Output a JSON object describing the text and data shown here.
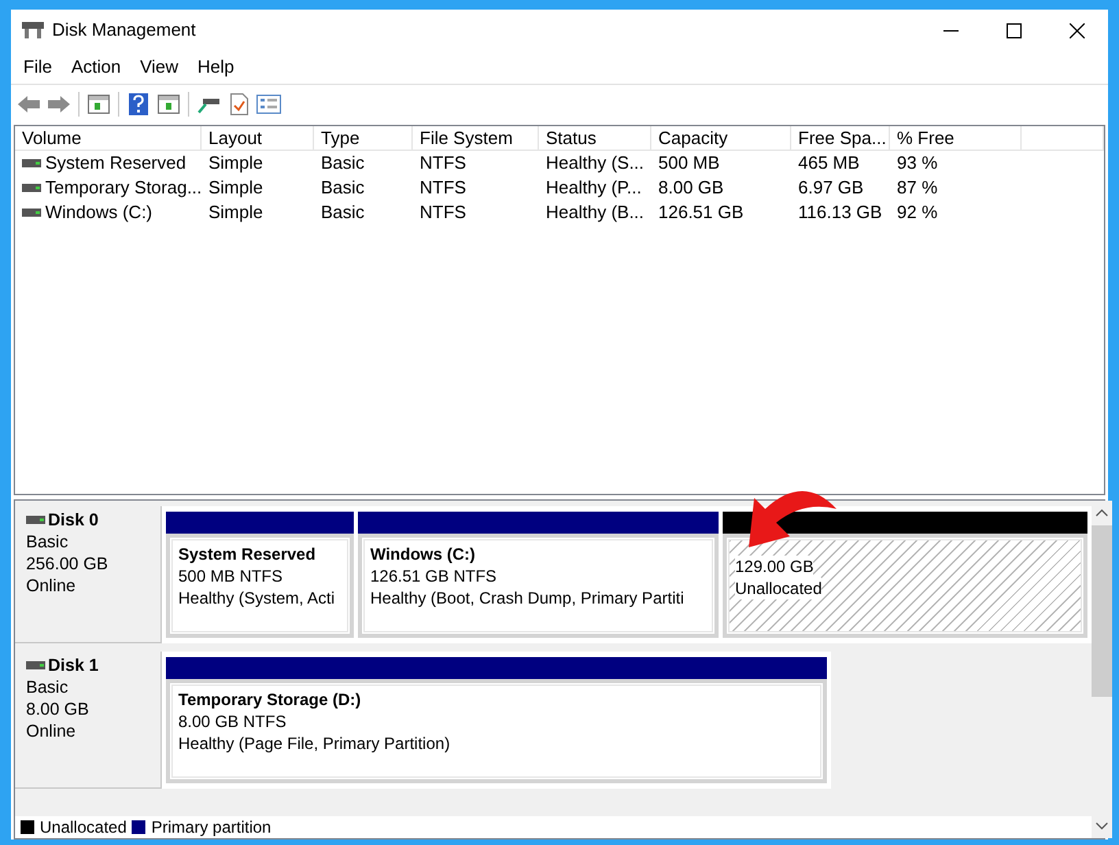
{
  "window": {
    "title": "Disk Management"
  },
  "menu": [
    "File",
    "Action",
    "View",
    "Help"
  ],
  "volume_table": {
    "columns": [
      "Volume",
      "Layout",
      "Type",
      "File System",
      "Status",
      "Capacity",
      "Free Spa...",
      "% Free"
    ],
    "rows": [
      {
        "cells": [
          "System Reserved",
          "Simple",
          "Basic",
          "NTFS",
          "Healthy (S...",
          "500 MB",
          "465 MB",
          "93 %"
        ]
      },
      {
        "cells": [
          "Temporary Storag...",
          "Simple",
          "Basic",
          "NTFS",
          "Healthy (P...",
          "8.00 GB",
          "6.97 GB",
          "87 %"
        ]
      },
      {
        "cells": [
          "Windows (C:)",
          "Simple",
          "Basic",
          "NTFS",
          "Healthy (B...",
          "126.51 GB",
          "116.13 GB",
          "92 %"
        ]
      }
    ]
  },
  "disks": [
    {
      "name": "Disk 0",
      "type": "Basic",
      "size": "256.00 GB",
      "status": "Online",
      "partitions": [
        {
          "kind": "primary",
          "title": "System Reserved",
          "detail": "500 MB NTFS",
          "status": "Healthy (System, Acti"
        },
        {
          "kind": "primary",
          "title": "Windows  (C:)",
          "detail": "126.51 GB NTFS",
          "status": "Healthy (Boot, Crash Dump, Primary Partiti"
        },
        {
          "kind": "unallocated",
          "detail": "129.00 GB",
          "status": "Unallocated"
        }
      ]
    },
    {
      "name": "Disk 1",
      "type": "Basic",
      "size": "8.00 GB",
      "status": "Online",
      "partitions": [
        {
          "kind": "primary",
          "title": "Temporary Storage  (D:)",
          "detail": "8.00 GB NTFS",
          "status": "Healthy (Page File, Primary Partition)"
        }
      ]
    }
  ],
  "legend": [
    {
      "label": "Unallocated",
      "color": "#000000"
    },
    {
      "label": "Primary partition",
      "color": "#000080"
    }
  ]
}
